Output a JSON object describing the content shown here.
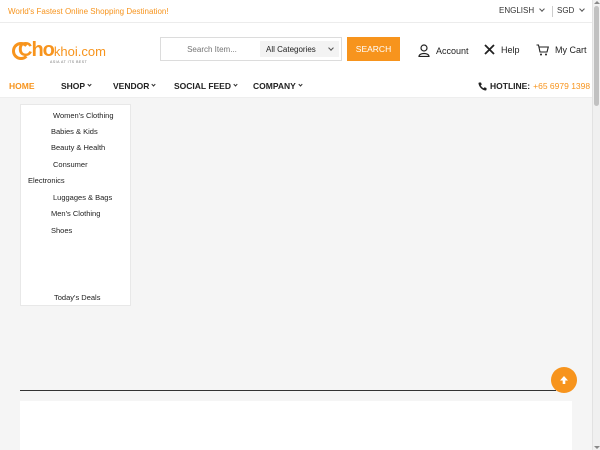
{
  "topbar": {
    "slogan": "World's Fastest Online Shopping Destination!",
    "language": "ENGLISH",
    "currency": "SGD"
  },
  "header": {
    "logo_main": "Cho",
    "logo_rest": "khoi.com",
    "logo_tagline": "ASIA AT ITS BEST",
    "search_placeholder": "Search Item...",
    "category_selected": "All Categories",
    "search_button": "SEARCH",
    "account_label": "Account",
    "help_label": "Help",
    "cart_label": "My Cart"
  },
  "nav": {
    "items": [
      {
        "label": "HOME"
      },
      {
        "label": "SHOP"
      },
      {
        "label": "VENDOR"
      },
      {
        "label": "SOCIAL FEED"
      },
      {
        "label": "COMPANY"
      }
    ],
    "hotline_label": "HOTLINE:",
    "hotline_number": "+65 6979 1398"
  },
  "category_menu": {
    "items": [
      {
        "label": "Women's Clothing"
      },
      {
        "label": "Babies & Kids"
      },
      {
        "label": "Beauty & Health"
      },
      {
        "label": "Consumer"
      },
      {
        "label": "Electronics"
      },
      {
        "label": "Luggages & Bags"
      },
      {
        "label": "Men's Clothing"
      },
      {
        "label": "Shoes"
      },
      {
        "label": "Today's Deals"
      }
    ]
  },
  "colors": {
    "accent": "#f7941d",
    "background": "#f5f5f5"
  },
  "icons": {
    "account": "user-icon",
    "help": "close-x-icon",
    "cart": "cart-icon",
    "hotline": "phone-icon",
    "scroll_top": "arrow-up-icon"
  }
}
